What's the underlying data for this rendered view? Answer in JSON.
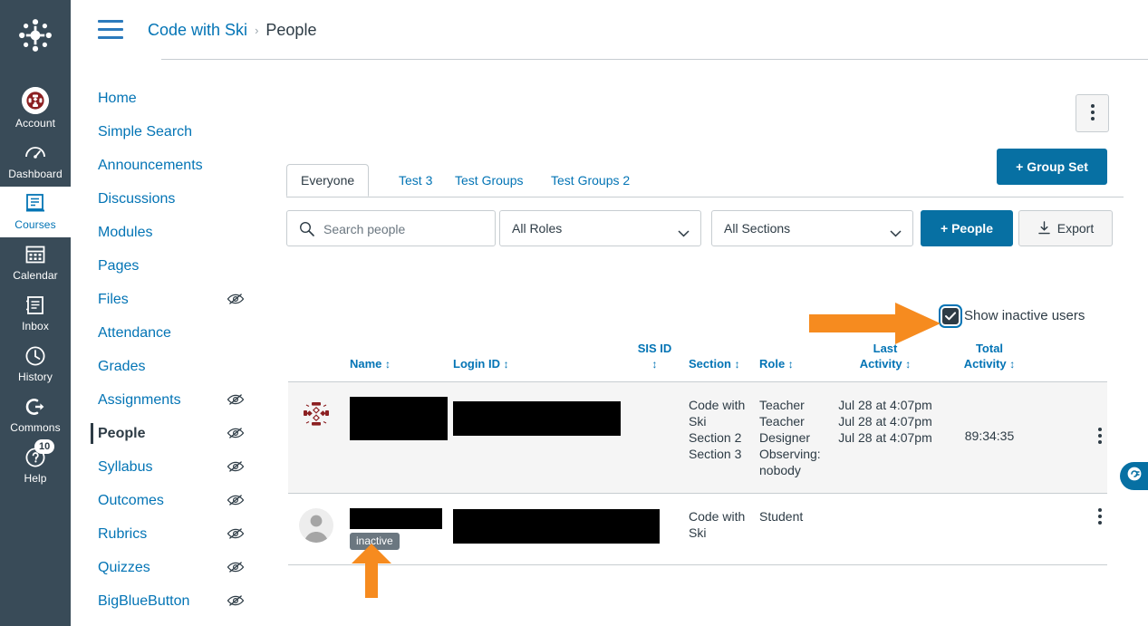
{
  "global_nav": {
    "logo": "canvas-logo",
    "items": [
      {
        "id": "account",
        "label": "Account",
        "icon": "user-avatar-icon",
        "active": false,
        "badge": null
      },
      {
        "id": "dashboard",
        "label": "Dashboard",
        "icon": "dashboard-icon",
        "active": false,
        "badge": null
      },
      {
        "id": "courses",
        "label": "Courses",
        "icon": "courses-book-icon",
        "active": true,
        "badge": null
      },
      {
        "id": "calendar",
        "label": "Calendar",
        "icon": "calendar-icon",
        "active": false,
        "badge": null
      },
      {
        "id": "inbox",
        "label": "Inbox",
        "icon": "inbox-envelope-icon",
        "active": false,
        "badge": null
      },
      {
        "id": "history",
        "label": "History",
        "icon": "clock-icon",
        "active": false,
        "badge": null
      },
      {
        "id": "commons",
        "label": "Commons",
        "icon": "commons-arrow-icon",
        "active": false,
        "badge": null
      },
      {
        "id": "help",
        "label": "Help",
        "icon": "help-question-icon",
        "active": false,
        "badge": "10"
      }
    ]
  },
  "topbar": {
    "menu_icon": "hamburger-icon",
    "breadcrumb": {
      "course": "Code with Ski",
      "separator": "›",
      "current": "People"
    }
  },
  "course_nav": {
    "items": [
      {
        "label": "Home",
        "hidden_icon": false,
        "active": false
      },
      {
        "label": "Simple Search",
        "hidden_icon": false,
        "active": false
      },
      {
        "label": "Announcements",
        "hidden_icon": false,
        "active": false
      },
      {
        "label": "Discussions",
        "hidden_icon": false,
        "active": false
      },
      {
        "label": "Modules",
        "hidden_icon": false,
        "active": false
      },
      {
        "label": "Pages",
        "hidden_icon": false,
        "active": false
      },
      {
        "label": "Files",
        "hidden_icon": true,
        "active": false
      },
      {
        "label": "Attendance",
        "hidden_icon": false,
        "active": false
      },
      {
        "label": "Grades",
        "hidden_icon": false,
        "active": false
      },
      {
        "label": "Assignments",
        "hidden_icon": true,
        "active": false
      },
      {
        "label": "People",
        "hidden_icon": true,
        "active": true
      },
      {
        "label": "Syllabus",
        "hidden_icon": true,
        "active": false
      },
      {
        "label": "Outcomes",
        "hidden_icon": true,
        "active": false
      },
      {
        "label": "Rubrics",
        "hidden_icon": true,
        "active": false
      },
      {
        "label": "Quizzes",
        "hidden_icon": true,
        "active": false
      },
      {
        "label": "BigBlueButton",
        "hidden_icon": true,
        "active": false
      }
    ]
  },
  "content": {
    "options_button": "kebab-menu-icon",
    "tabs": [
      {
        "label": "Everyone",
        "active": true
      },
      {
        "label": "Test 3",
        "active": false
      },
      {
        "label": "Test Groups",
        "active": false
      },
      {
        "label": "Test Groups 2",
        "active": false
      }
    ],
    "group_set_button": "+ Group Set",
    "toolbar": {
      "search_placeholder": "Search people",
      "search_value": "",
      "search_icon": "search-icon",
      "roles_select": "All Roles",
      "sections_select": "All Sections",
      "people_button": "+ People",
      "export_button": "Export",
      "export_icon": "download-icon"
    },
    "show_inactive": {
      "label": "Show inactive users",
      "checked": true
    },
    "table": {
      "columns": [
        {
          "label": "Name",
          "sort": "↕"
        },
        {
          "label": "Login ID",
          "sort": "↕"
        },
        {
          "label": "SIS ID",
          "sort": "↕"
        },
        {
          "label": "Section",
          "sort": "↕"
        },
        {
          "label": "Role",
          "sort": "↕"
        },
        {
          "label": "Last Activity",
          "sort": "↕"
        },
        {
          "label": "Total Activity",
          "sort": "↕"
        }
      ],
      "rows": [
        {
          "avatar": "user-avatar-pattern",
          "name": "",
          "name_redacted": true,
          "inactive_badge": null,
          "login_id": "",
          "login_redacted": true,
          "sis_id": "",
          "sections": [
            "Code with Ski",
            "Section 2",
            "Section 3"
          ],
          "roles": [
            "Teacher",
            "Teacher",
            "Designer",
            "Observing: nobody"
          ],
          "last_activity": [
            "Jul 28 at 4:07pm",
            "Jul 28 at 4:07pm",
            "Jul 28 at 4:07pm"
          ],
          "total_activity": "89:34:35",
          "menu_icon": "kebab-menu-icon"
        },
        {
          "avatar": "default-user-icon",
          "name": "",
          "name_redacted": true,
          "inactive_badge": "inactive",
          "login_id": "",
          "login_redacted": true,
          "sis_id": "",
          "sections": [
            "Code with Ski"
          ],
          "roles": [
            "Student"
          ],
          "last_activity": [],
          "total_activity": "",
          "menu_icon": "kebab-menu-icon"
        }
      ]
    }
  },
  "annotations": {
    "color": "#F68B1F",
    "arrow_to_checkbox": "arrow-right-pointing-to-show-inactive-checkbox",
    "arrow_to_badge": "arrow-up-pointing-to-inactive-badge"
  },
  "right_pill": {
    "icon": "chat-help-icon",
    "color": "#0770A3"
  }
}
